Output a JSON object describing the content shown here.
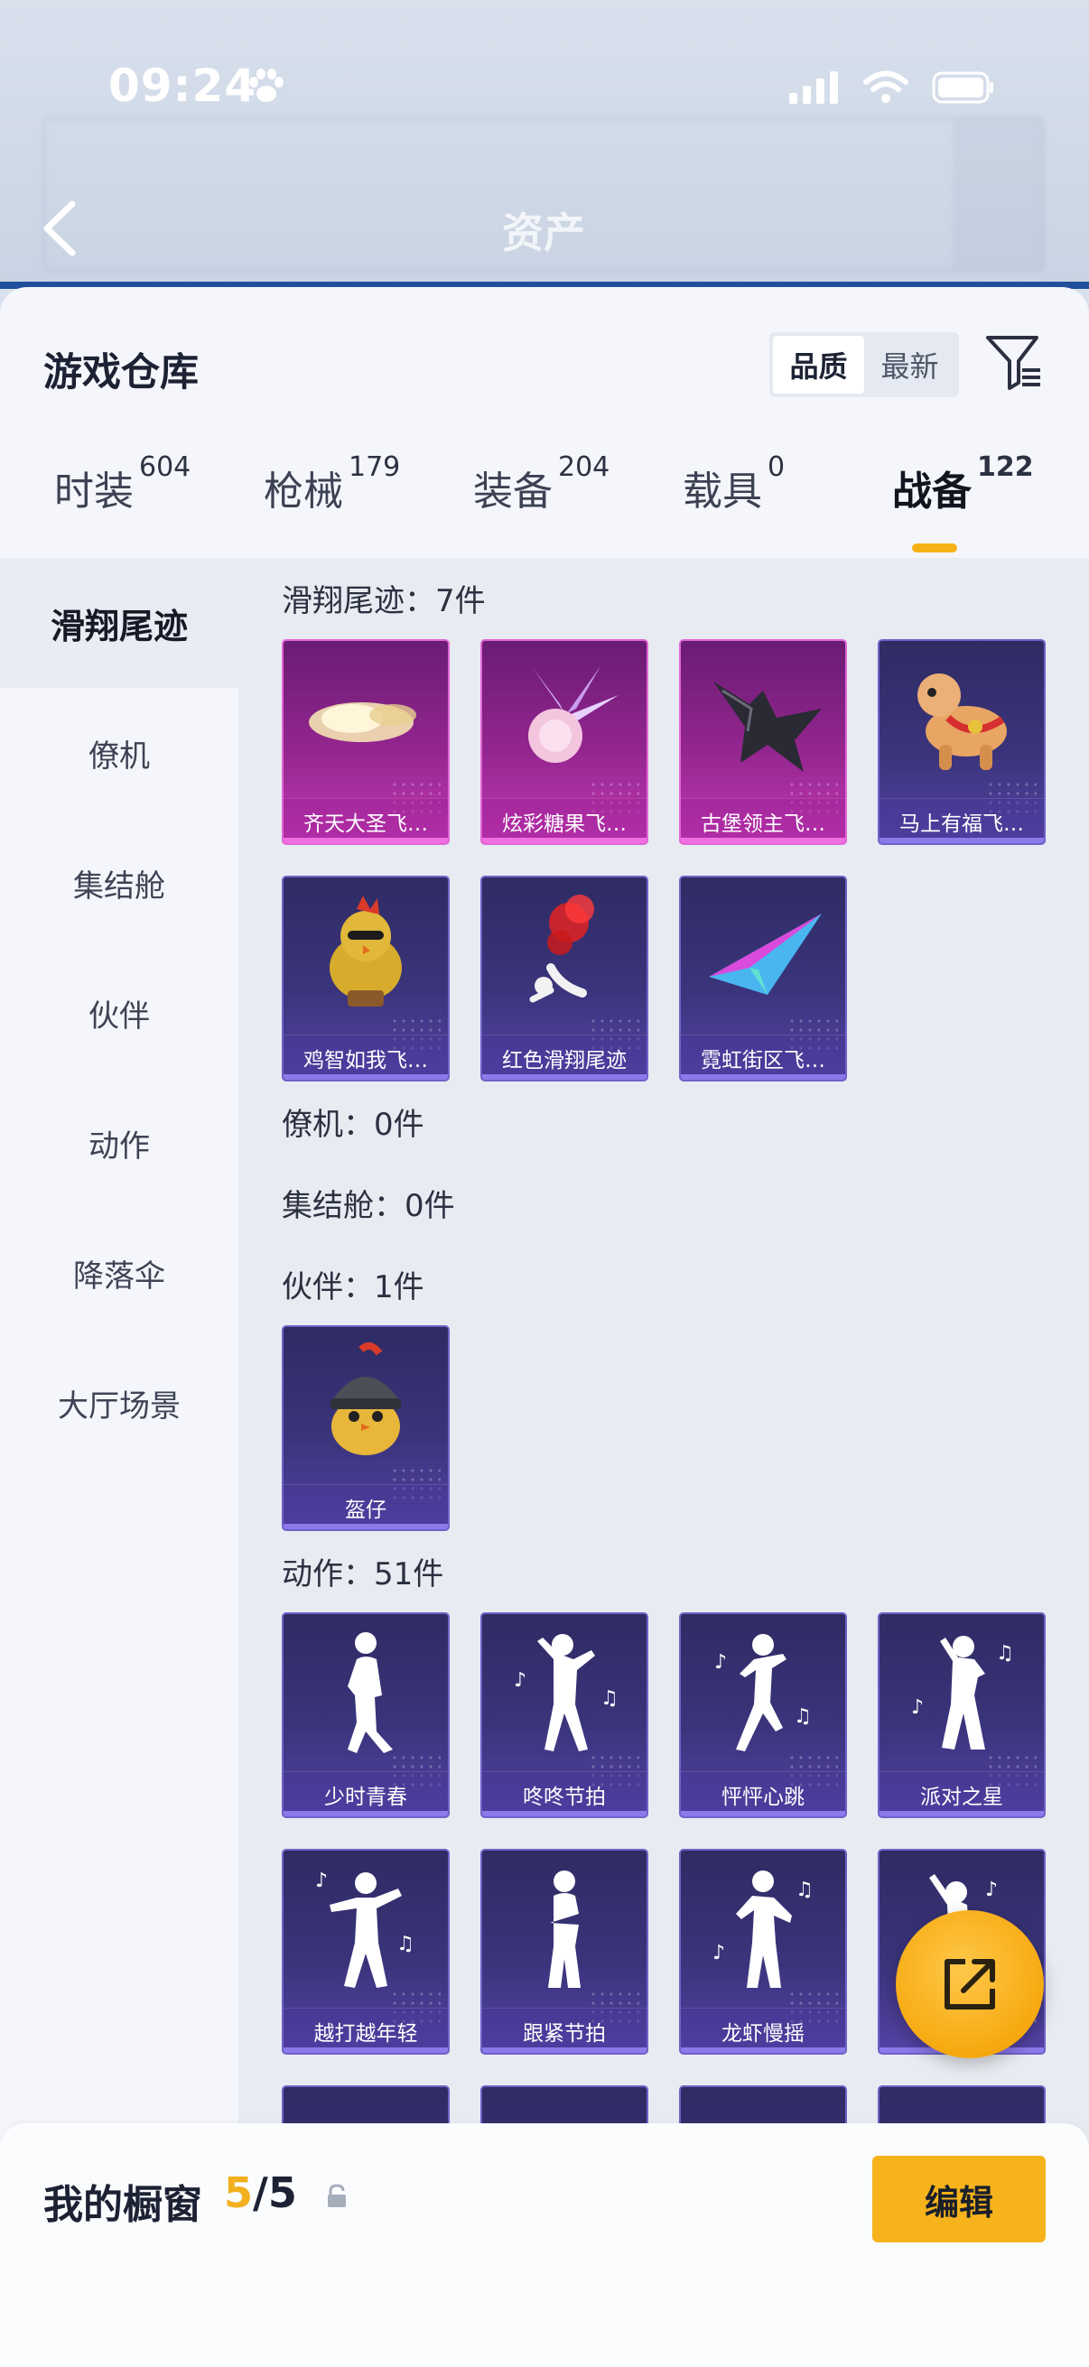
{
  "status_bar": {
    "time": "09:24"
  },
  "header_behind": {
    "title": "资产"
  },
  "sheet": {
    "title": "游戏仓库",
    "sort": {
      "options": [
        "品质",
        "最新"
      ],
      "selected": "品质"
    }
  },
  "tabs": [
    {
      "label": "时装",
      "count": "604"
    },
    {
      "label": "枪械",
      "count": "179"
    },
    {
      "label": "装备",
      "count": "204"
    },
    {
      "label": "载具",
      "count": "0"
    },
    {
      "label": "战备",
      "count": "122",
      "active": true
    }
  ],
  "sidebar": [
    {
      "label": "滑翔尾迹",
      "active": true
    },
    {
      "label": "僚机"
    },
    {
      "label": "集结舱"
    },
    {
      "label": "伙伴"
    },
    {
      "label": "动作"
    },
    {
      "label": "降落伞"
    },
    {
      "label": "大厅场景"
    }
  ],
  "sections": {
    "glide": {
      "label": "滑翔尾迹：7件",
      "items": [
        "齐天大圣飞…",
        "炫彩糖果飞…",
        "古堡领主飞…",
        "马上有福飞…",
        "鸡智如我飞…",
        "红色滑翔尾迹",
        "霓虹街区飞…"
      ]
    },
    "wingman": {
      "label": "僚机：0件"
    },
    "capsule": {
      "label": "集结舱：0件"
    },
    "partner": {
      "label": "伙伴：1件",
      "items": [
        "盔仔"
      ]
    },
    "emote": {
      "label": "动作：51件",
      "items": [
        "少时青春",
        "咚咚节拍",
        "怦怦心跳",
        "派对之星",
        "越打越年轻",
        "跟紧节拍",
        "龙虾慢摇"
      ]
    }
  },
  "showcase": {
    "label": "我的橱窗",
    "current": "5",
    "total": "/5",
    "edit_label": "编辑"
  },
  "colors": {
    "accent": "#f6b31c",
    "epic_card": "#94268f",
    "rare_card": "#3a347b"
  }
}
